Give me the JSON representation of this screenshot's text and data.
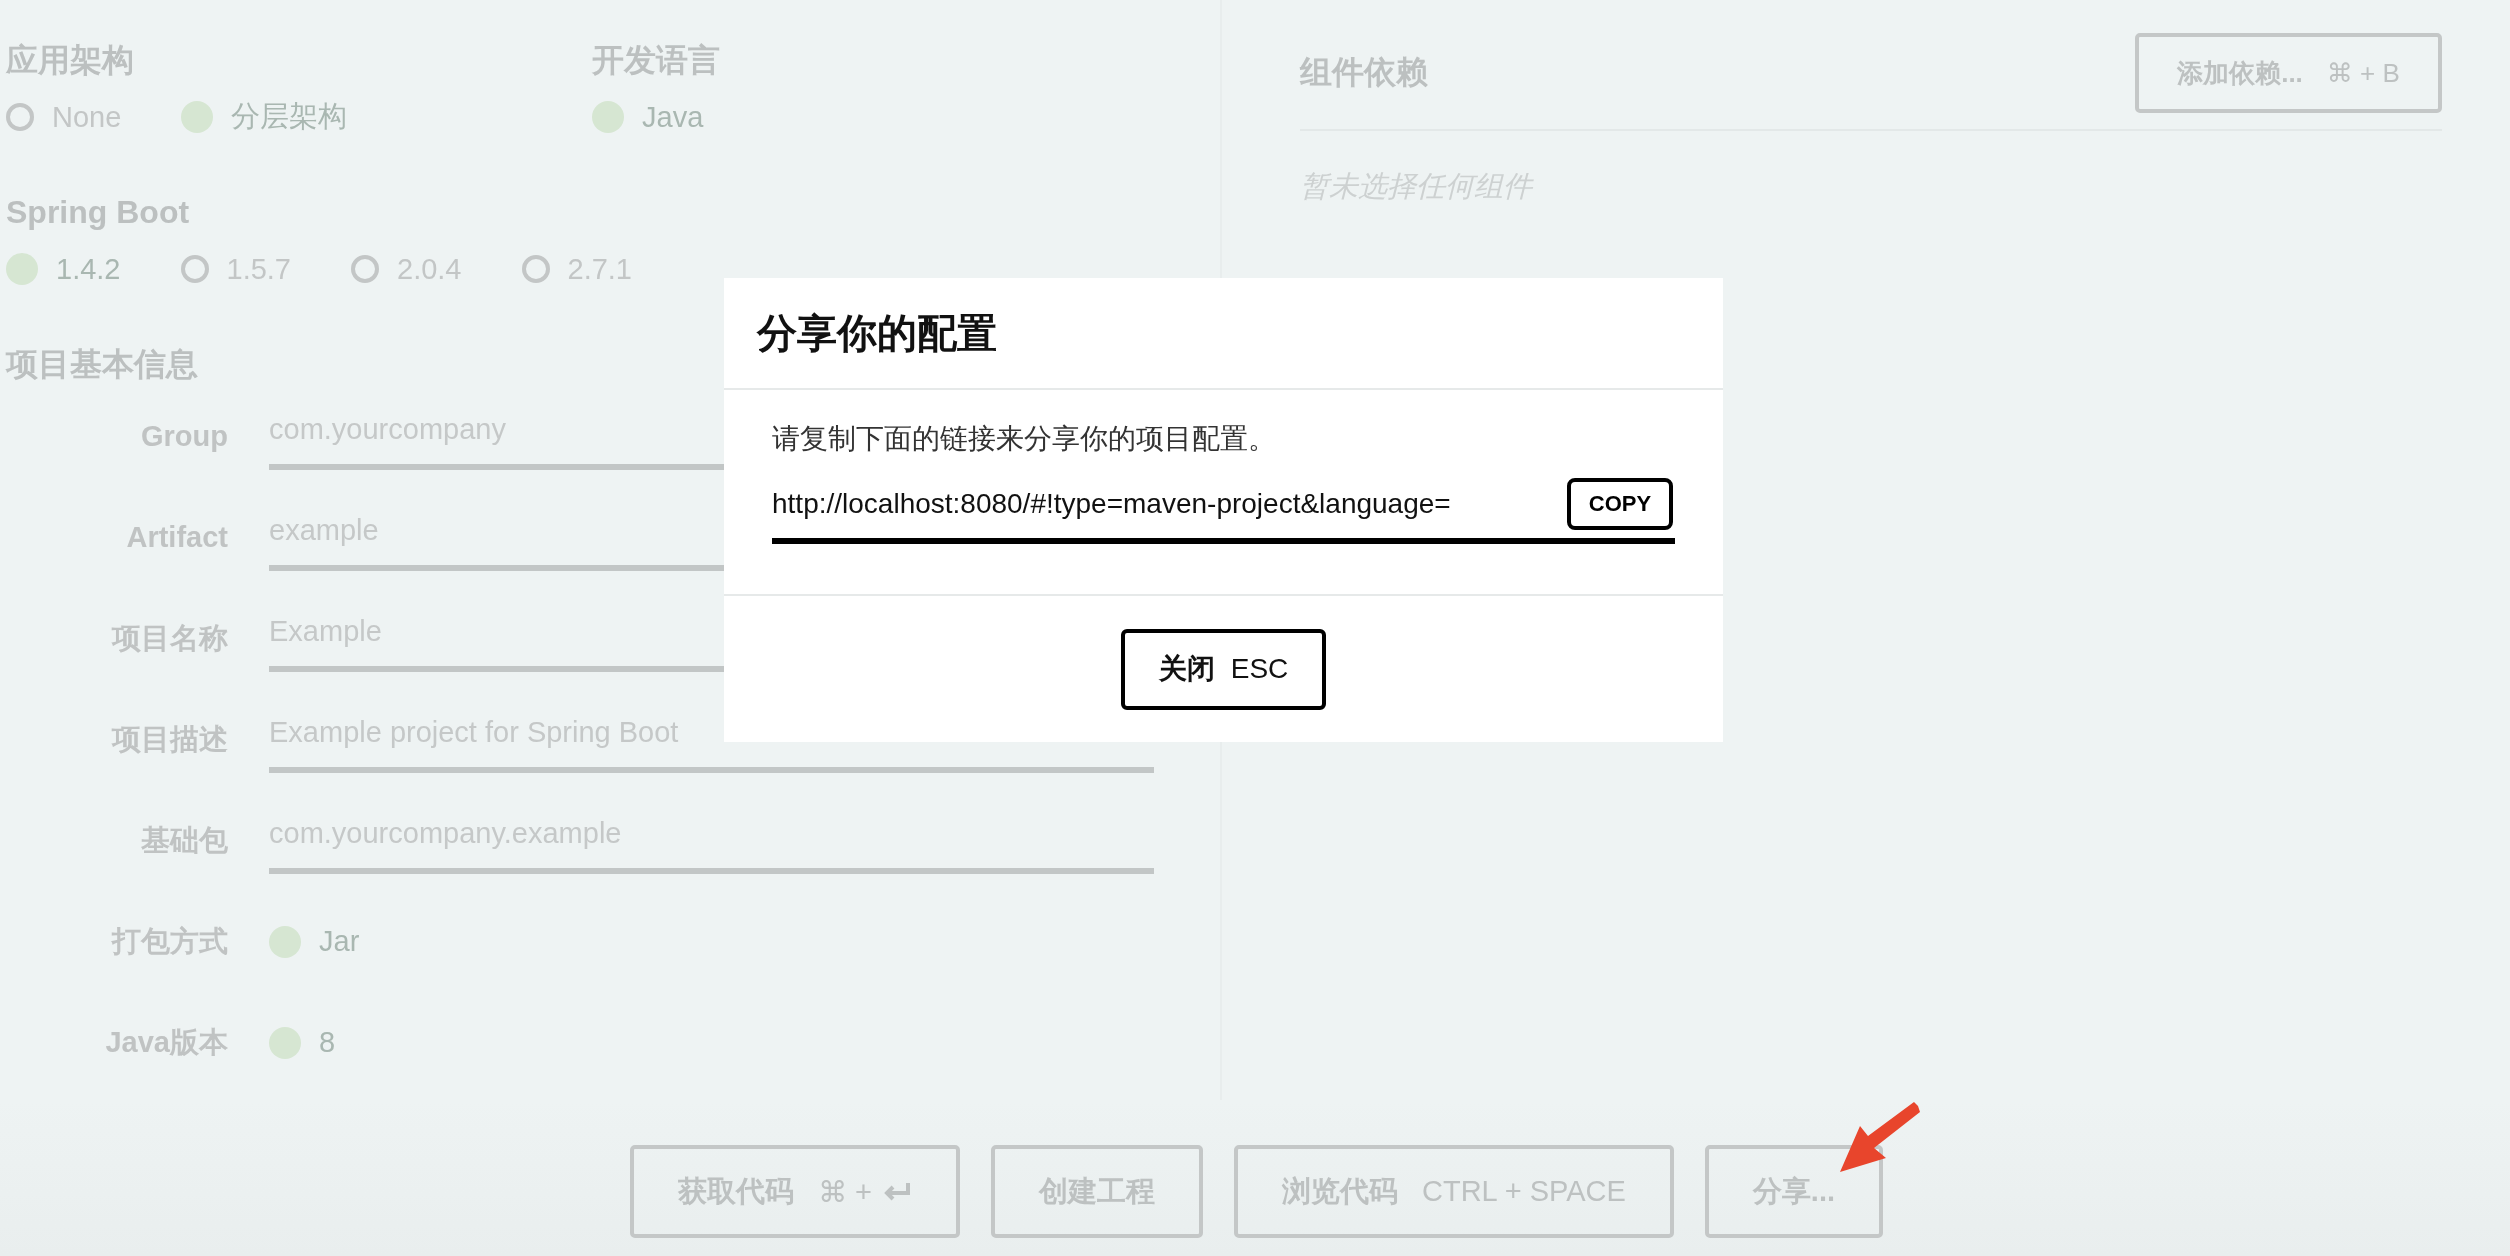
{
  "architecture": {
    "label": "应用架构",
    "options": [
      {
        "label": "None",
        "selected": false
      },
      {
        "label": "分层架构",
        "selected": true
      }
    ]
  },
  "language": {
    "label": "开发语言",
    "options": [
      {
        "label": "Java",
        "selected": true
      }
    ]
  },
  "spring_boot": {
    "label": "Spring Boot",
    "options": [
      {
        "label": "1.4.2",
        "selected": true
      },
      {
        "label": "1.5.7",
        "selected": false
      },
      {
        "label": "2.0.4",
        "selected": false
      },
      {
        "label": "2.7.1",
        "selected": false
      }
    ]
  },
  "project_info": {
    "title": "项目基本信息",
    "fields": [
      {
        "kind": "input",
        "label": "Group",
        "placeholder": "com.yourcompany"
      },
      {
        "kind": "input",
        "label": "Artifact",
        "placeholder": "example"
      },
      {
        "kind": "input",
        "label": "项目名称",
        "placeholder": "Example"
      },
      {
        "kind": "input",
        "label": "项目描述",
        "placeholder": "Example project for Spring Boot"
      },
      {
        "kind": "input",
        "label": "基础包",
        "placeholder": "com.yourcompany.example"
      },
      {
        "kind": "radio",
        "label": "打包方式",
        "options": [
          {
            "label": "Jar",
            "selected": true
          }
        ]
      },
      {
        "kind": "radio",
        "label": "Java版本",
        "options": [
          {
            "label": "8",
            "selected": true
          }
        ]
      }
    ]
  },
  "dependencies": {
    "title": "组件依赖",
    "button": {
      "label": "添加依赖...",
      "shortcut": "⌘ + B"
    },
    "empty_text": "暂未选择任何组件"
  },
  "actions": [
    {
      "label": "获取代码",
      "shortcut": "⌘ +",
      "kind": "enter"
    },
    {
      "label": "创建工程"
    },
    {
      "label": "浏览代码",
      "shortcut": "CTRL + SPACE"
    },
    {
      "label": "分享..."
    }
  ],
  "dialog": {
    "title": "分享你的配置",
    "message": "请复制下面的链接来分享你的项目配置。",
    "link": "http://localhost:8080/#!type=maven-project&language=",
    "copy_button": "COPY",
    "close_button": {
      "label": "关闭",
      "shortcut": "ESC"
    }
  }
}
